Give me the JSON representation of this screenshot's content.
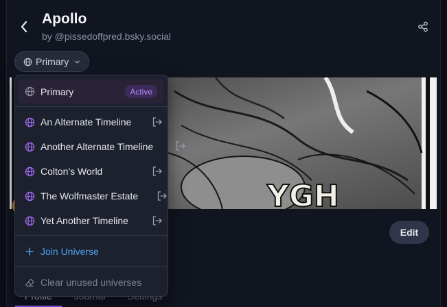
{
  "header": {
    "title": "Apollo",
    "handle": "by @pissedoffpred.bsky.social"
  },
  "universe_selector": {
    "current": "Primary"
  },
  "dropdown": {
    "active_item": {
      "label": "Primary",
      "badge": "Active"
    },
    "items": [
      {
        "label": "An Alternate Timeline"
      },
      {
        "label": "Another Alternate Timeline"
      },
      {
        "label": "Colton's World"
      },
      {
        "label": "The Wolfmaster Estate"
      },
      {
        "label": "Yet Another Timeline"
      }
    ],
    "join_label": "Join Universe",
    "clear_label": "Clear unused universes"
  },
  "banner": {
    "lettering": "YGH"
  },
  "profile": {
    "edit_label": "Edit"
  },
  "tabs": [
    {
      "label": "Profile"
    },
    {
      "label": "Journal"
    },
    {
      "label": "Settings"
    }
  ],
  "colors": {
    "accent_purple": "#8b5cf6",
    "link_blue": "#4ba3f0",
    "badge_text": "#b48cf5"
  },
  "icons": {
    "back": "chevron-left-icon",
    "share": "share-icon",
    "globe": "globe-icon",
    "leave": "leave-icon",
    "plus": "plus-icon",
    "eraser": "eraser-icon"
  }
}
